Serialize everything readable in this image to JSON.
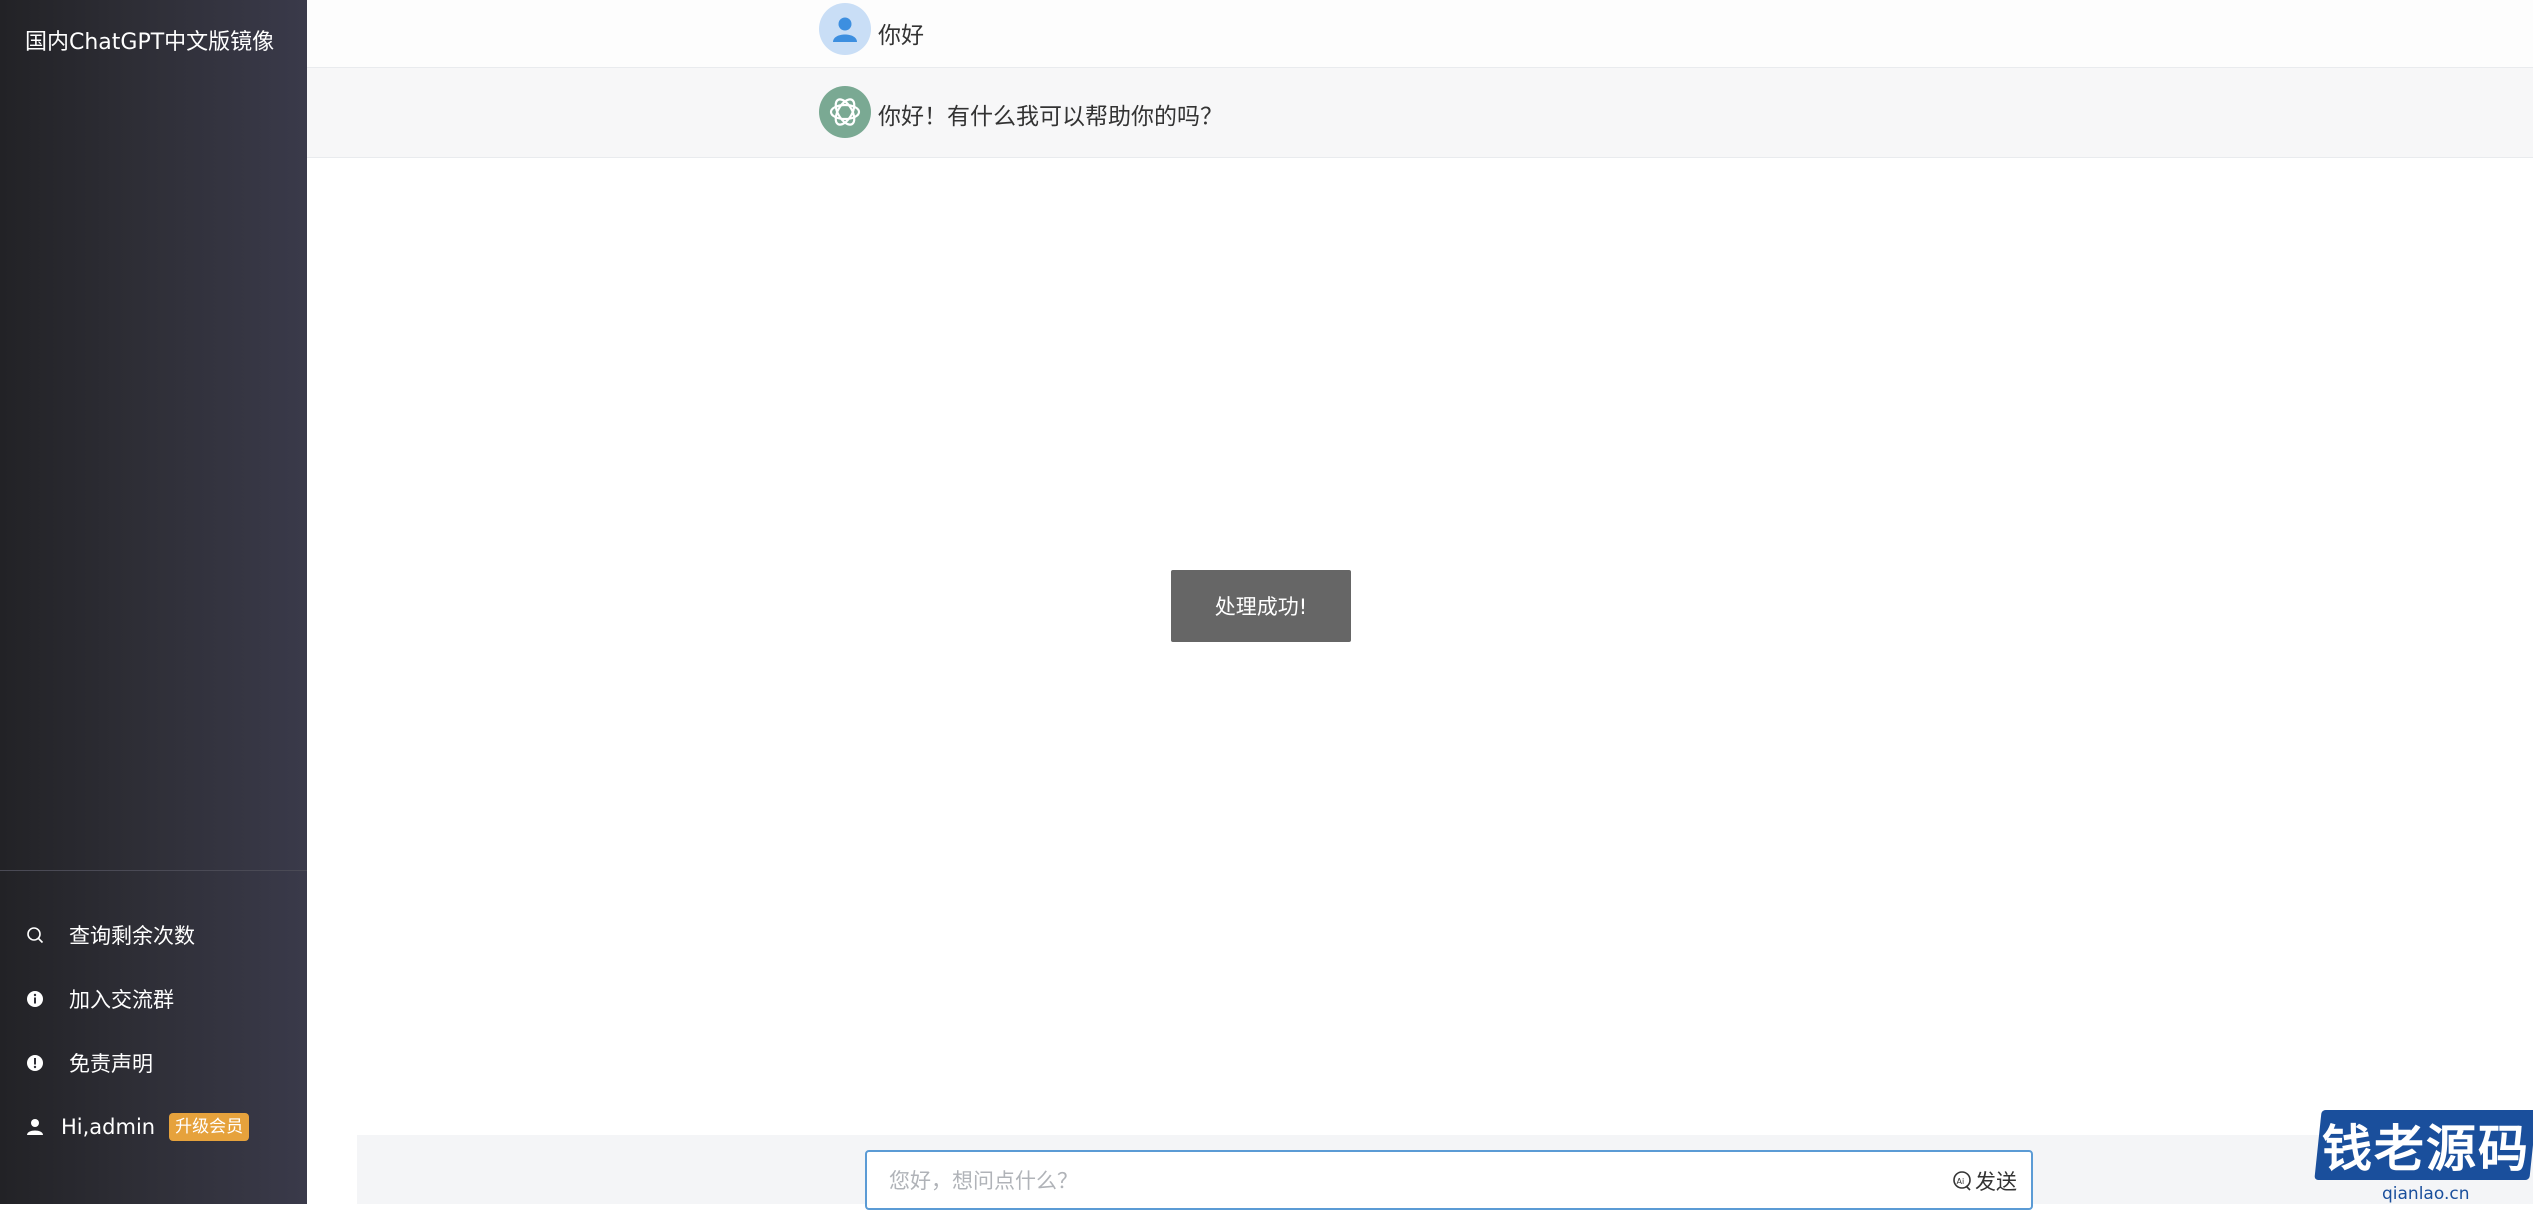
{
  "sidebar": {
    "brand": "国内ChatGPT中文版镜像",
    "items": [
      {
        "label": "查询剩余次数",
        "icon": "search-icon"
      },
      {
        "label": "加入交流群",
        "icon": "info-icon"
      },
      {
        "label": "免责声明",
        "icon": "alert-icon"
      }
    ],
    "user": {
      "label": "Hi,admin",
      "badge": "升级会员",
      "icon": "user-icon"
    }
  },
  "chat": {
    "messages": [
      {
        "role": "user",
        "text": "你好",
        "avatar": "user-avatar-icon"
      },
      {
        "role": "assistant",
        "text": "你好！有什么我可以帮助你的吗？",
        "avatar": "openai-logo-icon"
      }
    ]
  },
  "toast": {
    "text": "处理成功!"
  },
  "input": {
    "placeholder": "您好，想问点什么？",
    "send_label": "发送"
  },
  "watermark": {
    "text": "钱老源码",
    "sub": "qianlao.cn"
  },
  "colors": {
    "badge": "#e6a23c",
    "accent": "#5b9bd5",
    "toast": "#666666"
  }
}
